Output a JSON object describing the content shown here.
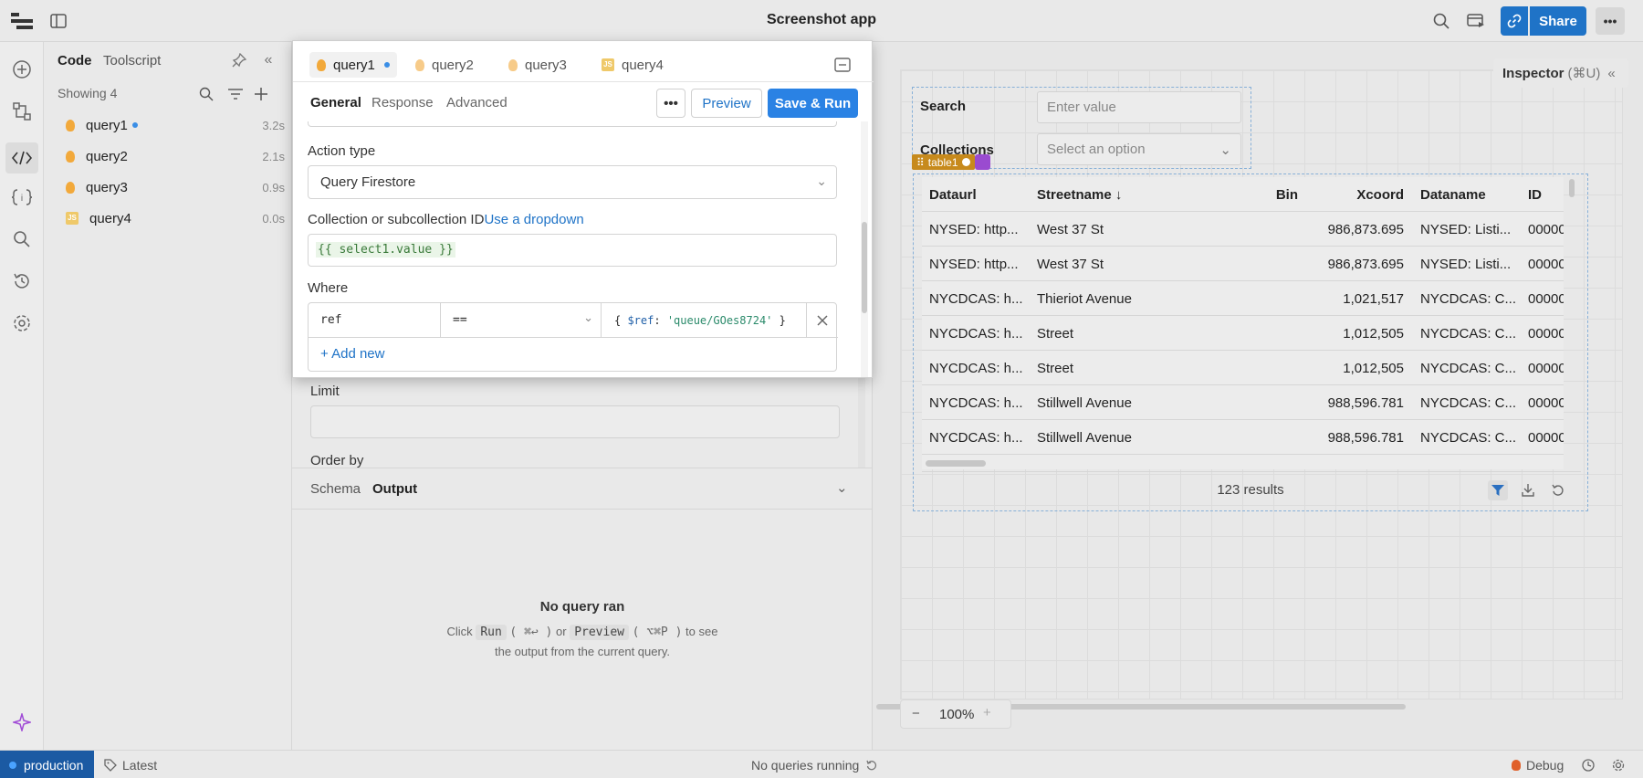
{
  "app": {
    "title": "Screenshot app"
  },
  "topbar": {
    "share_label": "Share",
    "more_label": "•••"
  },
  "code_panel": {
    "tab_code": "Code",
    "tab_toolscript": "Toolscript",
    "showing": "Showing 4",
    "queries": [
      {
        "name": "query1",
        "time": "3.2s",
        "type": "firestore",
        "modified": true
      },
      {
        "name": "query2",
        "time": "2.1s",
        "type": "firestore",
        "modified": false
      },
      {
        "name": "query3",
        "time": "0.9s",
        "type": "firestore",
        "modified": false
      },
      {
        "name": "query4",
        "time": "0.0s",
        "type": "js",
        "modified": false
      }
    ]
  },
  "editor": {
    "tabs": [
      "query1",
      "query2",
      "query3",
      "query4"
    ],
    "subtabs": {
      "general": "General",
      "response": "Response",
      "advanced": "Advanced"
    },
    "more_label": "•••",
    "preview_label": "Preview",
    "save_run_label": "Save & Run",
    "action_type_label": "Action type",
    "action_type_value": "Query Firestore",
    "collection_label": "Collection or subcollection ID",
    "collection_link": "Use a dropdown",
    "collection_value": "{{ select1.value }}",
    "where_label": "Where",
    "where_field": "ref",
    "where_op": "==",
    "where_value_prefix": "{ ",
    "where_value_key": "$ref",
    "where_value_colon": ": ",
    "where_value_str": "'queue/GOes8724'",
    "where_value_suffix": " }",
    "add_new": "+ Add new",
    "limit_label": "Limit",
    "order_by_label": "Order by",
    "output_tabs": {
      "schema": "Schema",
      "output": "Output"
    },
    "no_query_title": "No query ran",
    "no_query_click": "Click",
    "no_query_run": "Run",
    "no_query_run_key": "( ⌘↩ )",
    "no_query_or": "or",
    "no_query_preview": "Preview",
    "no_query_preview_key": "( ⌥⌘P )",
    "no_query_to_see": "to see",
    "no_query_line2": "the output from the current query."
  },
  "canvas": {
    "inspector_label": "Inspector",
    "inspector_shortcut": "(⌘U)",
    "search_label": "Search",
    "search_placeholder": "Enter value",
    "collections_label": "Collections",
    "collections_placeholder": "Select an option",
    "table_badge": "table1",
    "zoom": "100%",
    "zoom_minus": "−",
    "zoom_plus": "+",
    "table": {
      "columns": [
        "Dataurl",
        "Streetname ↓",
        "Bin",
        "Xcoord",
        "Dataname",
        "ID"
      ],
      "rows": [
        [
          "NYSED: http...",
          "West 37 St",
          "",
          "986,873.695",
          "NYSED: Listi...",
          "00000"
        ],
        [
          "NYSED: http...",
          "West 37 St",
          "",
          "986,873.695",
          "NYSED: Listi...",
          "00000"
        ],
        [
          "NYCDCAS: h...",
          "Thieriot Avenue",
          "",
          "1,021,517",
          "NYCDCAS: C...",
          "00000"
        ],
        [
          "NYCDCAS: h...",
          "Street",
          "",
          "1,012,505",
          "NYCDCAS: C...",
          "00000"
        ],
        [
          "NYCDCAS: h...",
          "Street",
          "",
          "1,012,505",
          "NYCDCAS: C...",
          "00000"
        ],
        [
          "NYCDCAS: h...",
          "Stillwell Avenue",
          "",
          "988,596.781",
          "NYCDCAS: C...",
          "00000"
        ],
        [
          "NYCDCAS: h...",
          "Stillwell Avenue",
          "",
          "988,596.781",
          "NYCDCAS: C...",
          "00000"
        ]
      ],
      "results": "123 results"
    }
  },
  "statusbar": {
    "env": "production",
    "version": "Latest",
    "status": "No queries running",
    "debug": "Debug"
  }
}
